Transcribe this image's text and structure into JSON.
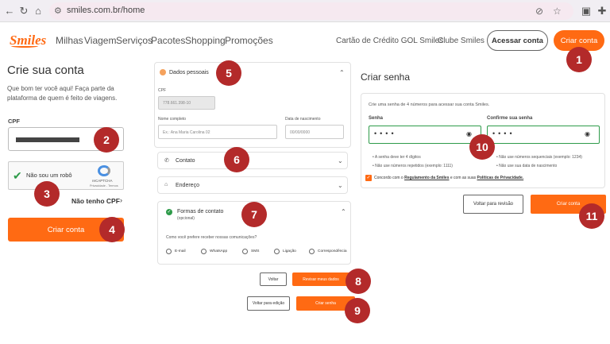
{
  "browser": {
    "url": "smiles.com.br/home",
    "back_icon": "arrow-left-icon",
    "reload_icon": "reload-icon",
    "home_icon": "home-icon"
  },
  "nav": {
    "logo": "Smiles",
    "links": [
      "Milhas",
      "Viagem",
      "Serviços",
      "Pacotes",
      "Shopping",
      "Promoções"
    ],
    "card_link": "Cartão de Crédito GOL Smiles",
    "club_link": "Clube Smiles",
    "login_button": "Acessar conta",
    "signup_button": "Criar conta"
  },
  "left": {
    "title": "Crie sua conta",
    "intro": "Que bom ter você aqui! Faça parte da plataforma de quem é feito de viagens.",
    "cpf_label": "CPF",
    "captcha_text": "Não sou um robô",
    "captcha_brand": "reCAPTCHA",
    "captcha_links": "Privacidade - Termos",
    "no_cpf": "Não tenho CPF",
    "submit": "Criar conta"
  },
  "middle": {
    "personal": {
      "title": "Dados pessoais",
      "cpf_label": "CPF",
      "cpf_value": "778.661.398-10",
      "name_label": "Nome completo",
      "name_placeholder": "Ex.: Ana Maria Carolina 02",
      "dob_label": "Data de nascimento",
      "dob_placeholder": "00/00/0000"
    },
    "contact_title": "Contato",
    "address_title": "Endereço",
    "forms": {
      "title": "Formas de contato",
      "subtitle": "(opcional)",
      "question": "Como você prefere receber nossas comunicações?",
      "options": [
        "E-mail",
        "WhatsApp",
        "SMS",
        "Ligação",
        "Correspondência"
      ]
    },
    "back_button": "Voltar",
    "review_button": "Revisar meus dados",
    "back_edit_button": "Voltar para edição",
    "create_password_button": "Criar senha"
  },
  "right": {
    "title": "Criar senha",
    "instructions": "Crie uma senha de 4 números para acessar sua conta Smiles.",
    "password_label": "Senha",
    "confirm_label": "Confirme sua senha",
    "password_value": "••••",
    "confirm_value": "••••",
    "rules_left": [
      "A senha deve ter 4 dígitos",
      "Não use números repetidos (exemplo: 1111)"
    ],
    "rules_right": [
      "Não use números sequenciais (exemplo: 1234)",
      "Não use sua data de nascimento"
    ],
    "consent_prefix": "Concordo com o ",
    "consent_link1": "Regulamento da Smiles",
    "consent_middle": " e com as suas ",
    "consent_link2": "Políticas de Privacidade.",
    "review_button": "Voltar para revisão",
    "submit": "Criar conta"
  },
  "markers": [
    "1",
    "2",
    "3",
    "4",
    "5",
    "6",
    "7",
    "8",
    "9",
    "10",
    "11"
  ]
}
